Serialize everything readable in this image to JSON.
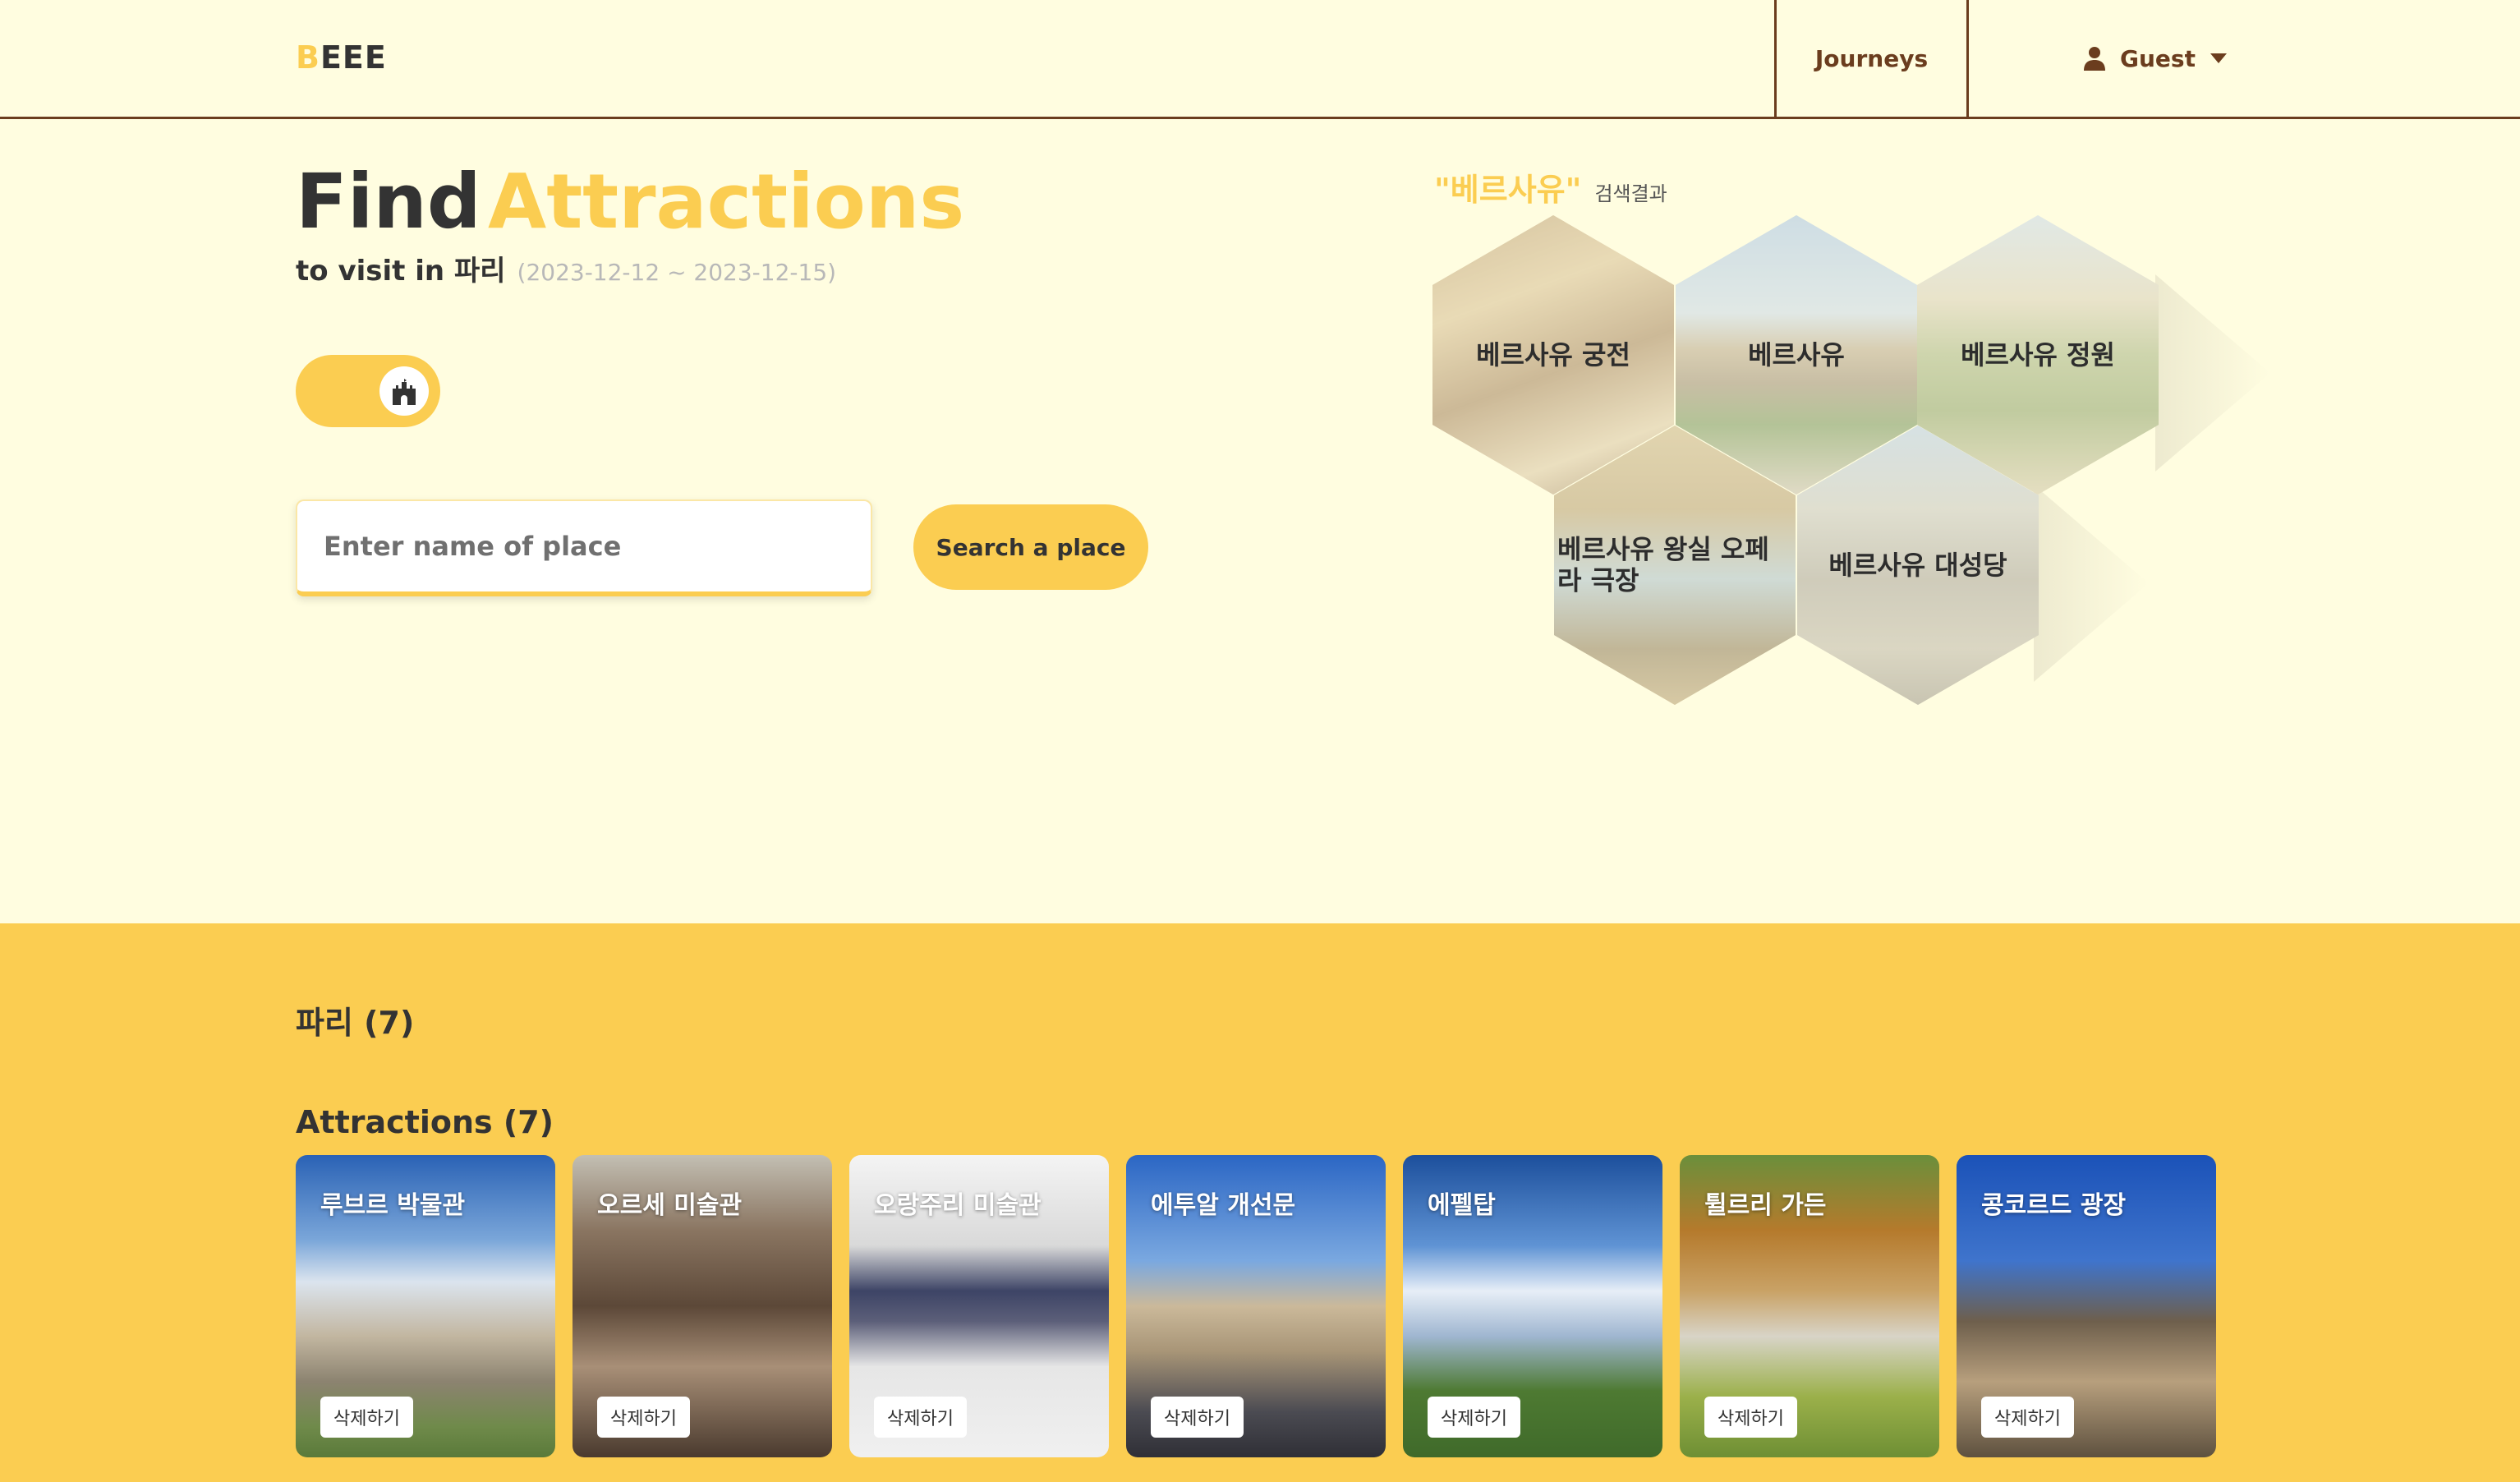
{
  "header": {
    "logo_first": "B",
    "logo_rest": "EEE",
    "journeys_label": "Journeys",
    "user_label": "Guest",
    "user_icon": "user-icon",
    "dropdown_icon": "caret-down-icon"
  },
  "hero": {
    "title_find": "Find",
    "title_attractions": "Attractions",
    "subtitle": "to visit in 파리",
    "dates": "(2023-12-12 ~ 2023-12-15)",
    "toggle_icon": "castle-icon"
  },
  "search": {
    "placeholder": "Enter name of place",
    "value": "",
    "button_label": "Search a place"
  },
  "results": {
    "query": "\"베르사유\"",
    "label": "검색결과",
    "items": [
      {
        "label": "베르사유 궁전"
      },
      {
        "label": "베르사유"
      },
      {
        "label": "베르사유 정원"
      },
      {
        "label": "베르사유 왕실 오페라 극장"
      },
      {
        "label": "베르사유 대성당"
      }
    ]
  },
  "city": {
    "heading": "파리 (7)"
  },
  "attractions": {
    "heading": "Attractions (7)",
    "delete_label": "삭제하기",
    "items": [
      {
        "name": "루브르 박물관"
      },
      {
        "name": "오르세 미술관"
      },
      {
        "name": "오랑주리 미술관"
      },
      {
        "name": "에투알 개선문"
      },
      {
        "name": "에펠탑"
      },
      {
        "name": "튈르리 가든"
      },
      {
        "name": "콩코르드 광장"
      }
    ]
  },
  "colors": {
    "accent": "#fbcd51",
    "background": "#fffde0",
    "header_border": "#6b3d1e"
  }
}
